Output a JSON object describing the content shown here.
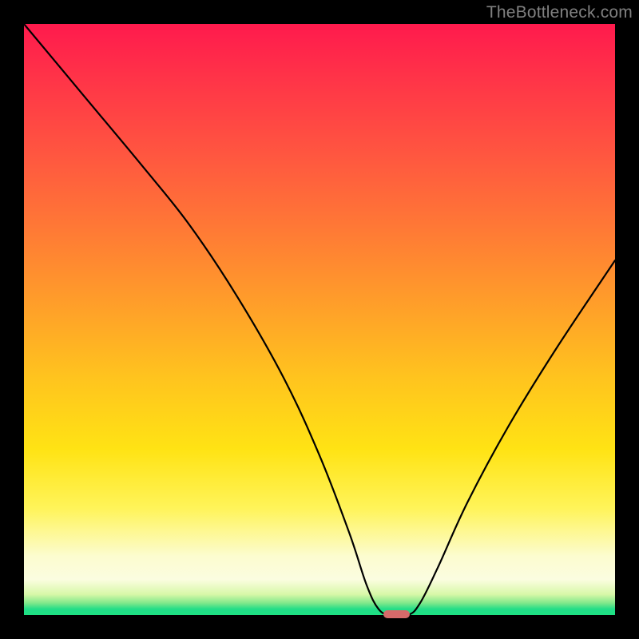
{
  "watermark": "TheBottleneck.com",
  "chart_data": {
    "type": "line",
    "title": "",
    "xlabel": "",
    "ylabel": "",
    "xlim": [
      0,
      100
    ],
    "ylim": [
      0,
      100
    ],
    "grid": false,
    "series": [
      {
        "name": "bottleneck-curve",
        "x": [
          0,
          10,
          20,
          28,
          36,
          44,
          50,
          55,
          58,
          60,
          62,
          65,
          67,
          70,
          75,
          82,
          90,
          100
        ],
        "values": [
          100,
          88,
          76,
          66,
          54,
          40,
          27,
          14,
          5,
          1,
          0,
          0,
          2,
          8,
          19,
          32,
          45,
          60
        ]
      }
    ],
    "marker": {
      "x": 63,
      "y": 0,
      "width_pct": 4.5,
      "height_pct": 1.4,
      "color": "#d66a6a"
    },
    "background_gradient": {
      "type": "linear-vertical",
      "stops": [
        {
          "pos": 0.0,
          "color": "#ff1a4d"
        },
        {
          "pos": 0.35,
          "color": "#ff7a35"
        },
        {
          "pos": 0.72,
          "color": "#ffe314"
        },
        {
          "pos": 0.92,
          "color": "#fbfde0"
        },
        {
          "pos": 1.0,
          "color": "#1ee183"
        }
      ]
    }
  }
}
